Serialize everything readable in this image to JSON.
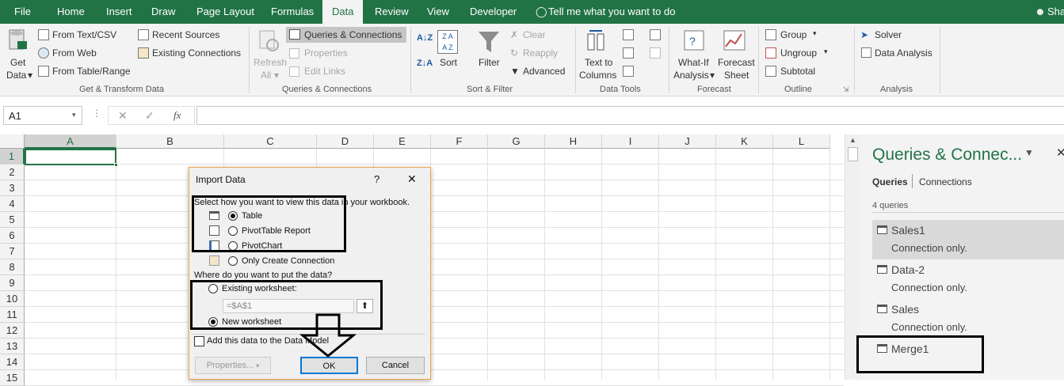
{
  "tabs": [
    "File",
    "Home",
    "Insert",
    "Draw",
    "Page Layout",
    "Formulas",
    "Data",
    "Review",
    "View",
    "Developer"
  ],
  "tell_me": "Tell me what you want to do",
  "user_initials": "Sha",
  "ribbon": {
    "get_data": "Get",
    "get_data2": "Data",
    "from_text_csv": "From Text/CSV",
    "from_web": "From Web",
    "from_table_range": "From Table/Range",
    "recent_sources": "Recent Sources",
    "existing_connections": "Existing Connections",
    "group_get_transform": "Get & Transform Data",
    "refresh": "Refresh",
    "refresh_all": "All",
    "queries_connections": "Queries & Connections",
    "properties": "Properties",
    "edit_links": "Edit Links",
    "group_queries": "Queries & Connections",
    "sort": "Sort",
    "filter": "Filter",
    "clear": "Clear",
    "reapply": "Reapply",
    "advanced": "Advanced",
    "group_sort_filter": "Sort & Filter",
    "text_to": "Text to",
    "columns": "Columns",
    "group_data_tools": "Data Tools",
    "what_if": "What-If",
    "analysis": "Analysis",
    "forecast": "Forecast",
    "sheet": "Sheet",
    "group_forecast": "Forecast",
    "group": "Group",
    "ungroup": "Ungroup",
    "subtotal": "Subtotal",
    "group_outline": "Outline",
    "solver": "Solver",
    "data_analysis": "Data Analysis",
    "group_analysis": "Analysis"
  },
  "formula_bar": {
    "name_box": "A1",
    "fx": "fx"
  },
  "columns": [
    "A",
    "B",
    "C",
    "D",
    "E",
    "F",
    "G",
    "H",
    "I",
    "J",
    "K",
    "L"
  ],
  "rows": [
    "1",
    "2",
    "3",
    "4",
    "5",
    "6",
    "7",
    "8",
    "9",
    "10",
    "11",
    "12",
    "13",
    "14",
    "15"
  ],
  "pane": {
    "title": "Queries & Connec...",
    "tab_queries": "Queries",
    "tab_connections": "Connections",
    "count": "4 queries",
    "items": [
      {
        "name": "Sales1",
        "status": "Connection only."
      },
      {
        "name": "Data-2",
        "status": "Connection only."
      },
      {
        "name": "Sales",
        "status": "Connection only."
      },
      {
        "name": "Merge1",
        "status": ""
      }
    ]
  },
  "dialog": {
    "title": "Import Data",
    "help": "?",
    "close": "✕",
    "view_prompt": "Select how you want to view this data in your workbook.",
    "opt_table": "Table",
    "opt_pivot_table": "PivotTable Report",
    "opt_pivot_chart": "PivotChart",
    "opt_connection": "Only Create Connection",
    "put_prompt": "Where do you want to put the data?",
    "opt_existing": "Existing worksheet:",
    "ref_value": "=$A$1",
    "opt_new": "New worksheet",
    "add_model": "Add this data to the Data Model",
    "properties_btn": "Properties...",
    "ok_btn": "OK",
    "cancel_btn": "Cancel"
  },
  "colors": {
    "excel_green": "#217346",
    "annotation": "#000000"
  }
}
